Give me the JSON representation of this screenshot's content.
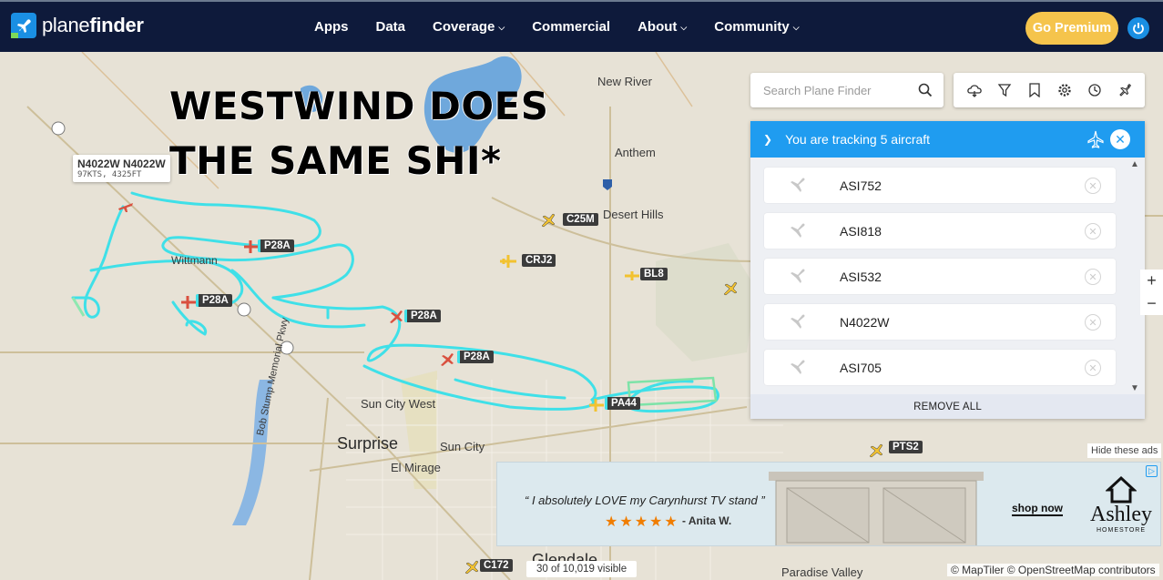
{
  "brand": {
    "name_light": "plane",
    "name_bold": "finder",
    "accent": "#1a8fe3"
  },
  "nav": {
    "items": [
      {
        "label": "Apps",
        "dropdown": false
      },
      {
        "label": "Data",
        "dropdown": false
      },
      {
        "label": "Coverage",
        "dropdown": true
      },
      {
        "label": "Commercial",
        "dropdown": false
      },
      {
        "label": "About",
        "dropdown": true
      },
      {
        "label": "Community",
        "dropdown": true
      }
    ],
    "premium_label": "Go Premium",
    "premium_color": "#f5c44c"
  },
  "overlay": {
    "line1": "WESTWIND DOES",
    "line2": "THE SAME SHI*"
  },
  "map": {
    "places": [
      {
        "name": "New River"
      },
      {
        "name": "Anthem"
      },
      {
        "name": "Desert Hills"
      },
      {
        "name": "Wittmann"
      },
      {
        "name": "Sun City West"
      },
      {
        "name": "Surprise"
      },
      {
        "name": "Sun City"
      },
      {
        "name": "El Mirage"
      },
      {
        "name": "Glendale"
      },
      {
        "name": "Paradise Valley"
      },
      {
        "name": "Bob Stump Memorial Pkwy"
      }
    ],
    "aircraft_tags": [
      "C25M",
      "CRJ2",
      "BL8",
      "P28A",
      "P28A",
      "P28A",
      "P28A",
      "PA44",
      "PTS2",
      "C172"
    ],
    "selected": {
      "title": "N4022W N4022W",
      "speed_alt": "97KTS, 4325FT"
    },
    "track_color": "#3fe0e8"
  },
  "search": {
    "placeholder": "Search Plane Finder"
  },
  "tools": [
    "weather-icon",
    "filter-icon",
    "bookmark-icon",
    "settings-icon",
    "history-icon",
    "add-aircraft-icon"
  ],
  "tracking": {
    "header": "You are tracking 5 aircraft",
    "aircraft": [
      "ASI752",
      "ASI818",
      "ASI532",
      "N4022W",
      "ASI705"
    ],
    "remove_all": "REMOVE ALL",
    "header_color": "#1f9cf0"
  },
  "zoom": {
    "in": "+",
    "out": "−"
  },
  "ad": {
    "hide_label": "Hide these ads",
    "quote": "“ I absolutely LOVE my Carynhurst TV stand ”",
    "stars": "★★★★★",
    "author": "- Anita W.",
    "cta": "shop now",
    "brand": "Ashley",
    "brand_sub": "HOMESTORE"
  },
  "status": {
    "visible": "30 of 10,019 visible",
    "attribution": "© MapTiler © OpenStreetMap contributors"
  }
}
